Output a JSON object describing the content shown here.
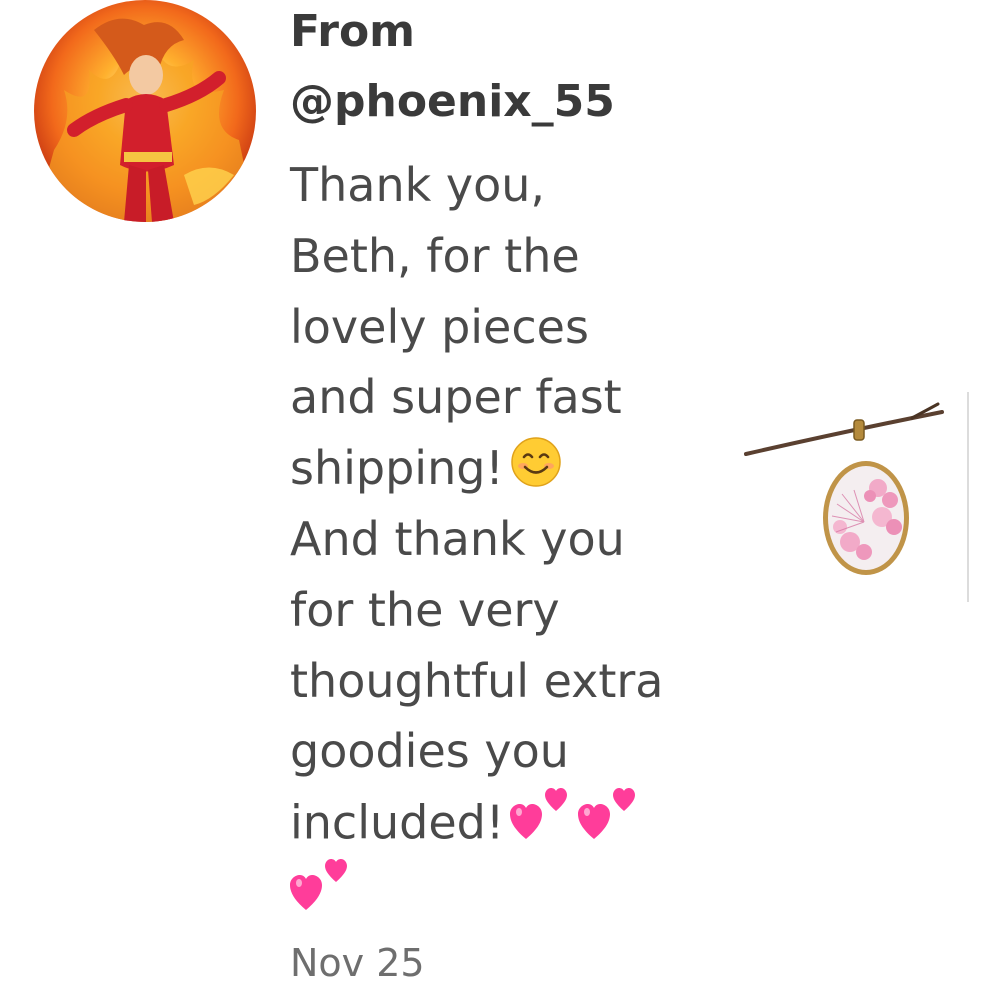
{
  "review": {
    "from_label": "From",
    "username": "@phoenix_55",
    "message_lines": [
      "Thank you,",
      "Beth, for the",
      "lovely pieces",
      "and super fast",
      "shipping!",
      "And thank you",
      "for the very",
      "thoughtful extra",
      "goodies you",
      "included!"
    ],
    "date": "Nov 25"
  },
  "icons": {
    "smile_emoji": "smiling-face-emoji",
    "hearts_emoji": "two-hearts-emoji"
  },
  "colors": {
    "text_dark": "#3a3a3a",
    "text_body": "#4a4a4a",
    "text_muted": "#6e6e6e",
    "heart_pink": "#ff4fa3"
  }
}
